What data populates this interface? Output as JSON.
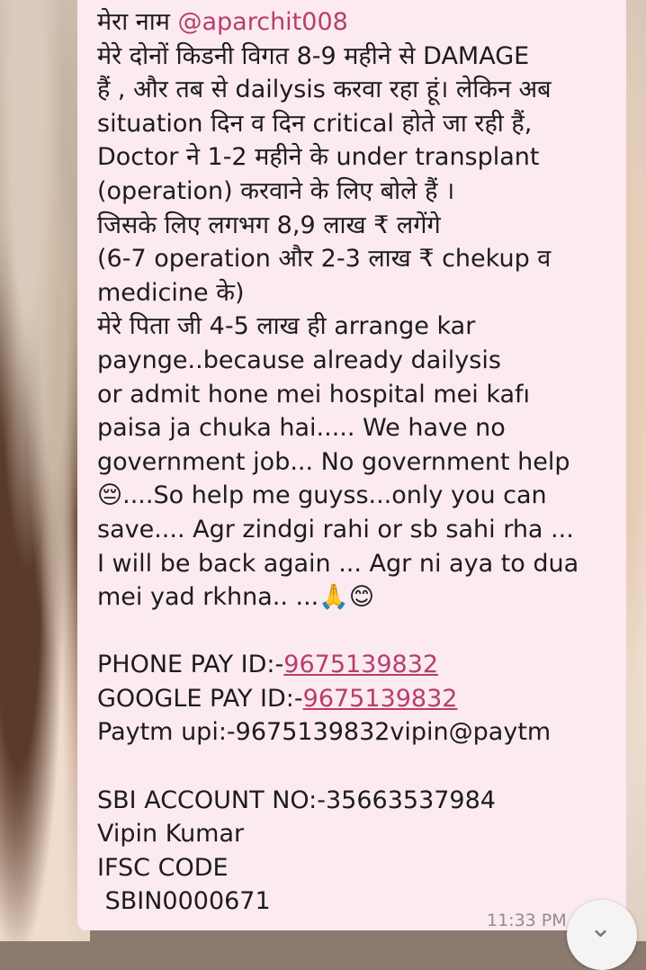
{
  "message": {
    "lines": [
      {
        "pre": "मेरा नाम ",
        "mention": "@aparchit008"
      },
      "मेरे दोनों किडनी विगत 8-9 महीने से DAMAGE",
      "हैं , और तब से dailysis करवा रहा हूं। लेकिन अब",
      "situation दिन व दिन critical होते जा रही हैं,",
      "Doctor ने 1-2 महीने के under transplant",
      "(operation) करवाने के लिए बोले हैं ।",
      "जिसके लिए लगभग 8,9 लाख ₹ लगेंगे",
      "(6-7 operation और 2-3 लाख ₹ chekup व",
      "medicine के)",
      "मेरे पिता जी  4-5  लाख ही  arrange kar",
      "paynge..because already dailysis",
      "or admit hone mei hospital mei kafı",
      "paisa ja chuka hai..... We have no",
      "government job... No government help",
      "😔....So help me guyss...only you can",
      "save.... Agr zindgi rahi or sb sahi rha ...",
      "I will be back again ... Agr ni aya to dua",
      "mei yad rkhna.. ...🙏😊"
    ],
    "payments": [
      {
        "label": "PHONE PAY ID:-",
        "link": "9675139832"
      },
      {
        "label": "GOOGLE PAY ID:-",
        "link": "9675139832"
      },
      {
        "label": "Paytm upi:-9675139832vipin@paytm",
        "link": ""
      }
    ],
    "bank": [
      "SBI ACCOUNT NO:-35663537984",
      "Vipin Kumar",
      "IFSC CODE",
      " SBIN0000671"
    ],
    "timestamp": "11:33 PM"
  },
  "scroll_button": {
    "icon": "chevron-down-icon",
    "glyph": "⌄"
  }
}
